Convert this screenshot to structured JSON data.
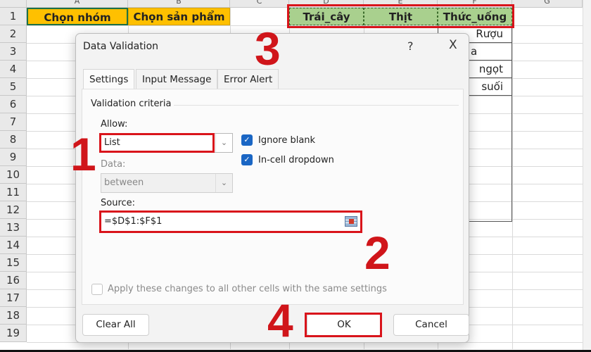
{
  "sheet": {
    "columns": [
      "A",
      "B",
      "C",
      "D",
      "E",
      "F",
      "G"
    ],
    "rows": [
      "1",
      "2",
      "3",
      "4",
      "5",
      "6",
      "7",
      "8",
      "9",
      "10",
      "11",
      "12",
      "13",
      "14",
      "15",
      "16",
      "17",
      "18",
      "19"
    ],
    "cells": {
      "A1": "Chọn nhóm",
      "B1": "Chọn sản phẩm",
      "D1": "Trái_cây",
      "E1": "Thịt",
      "F1": "Thức_uống",
      "F2": "Rượu",
      "F3": "a",
      "F4": "ngọt",
      "F5": "suối"
    },
    "colors": {
      "header_yellow": "#ffc000",
      "header_green": "#a9d08e",
      "highlight_red": "#d9141b"
    }
  },
  "annotations": [
    "1",
    "2",
    "3",
    "4"
  ],
  "dialog": {
    "title": "Data Validation",
    "help": "?",
    "close": "X",
    "tabs": [
      "Settings",
      "Input Message",
      "Error Alert"
    ],
    "active_tab": "Settings",
    "section": "Validation criteria",
    "allow_label": "Allow:",
    "allow_value": "List",
    "data_label": "Data:",
    "data_value": "between",
    "ignore_blank": {
      "label": "Ignore blank",
      "checked": true
    },
    "in_cell_dropdown": {
      "label": "In-cell dropdown",
      "checked": true
    },
    "source_label": "Source:",
    "source_value": "=$D$1:$F$1",
    "apply_all": {
      "label": "Apply these changes to all other cells with the same settings",
      "checked": false
    },
    "buttons": {
      "clear_all": "Clear All",
      "ok": "OK",
      "cancel": "Cancel"
    }
  }
}
